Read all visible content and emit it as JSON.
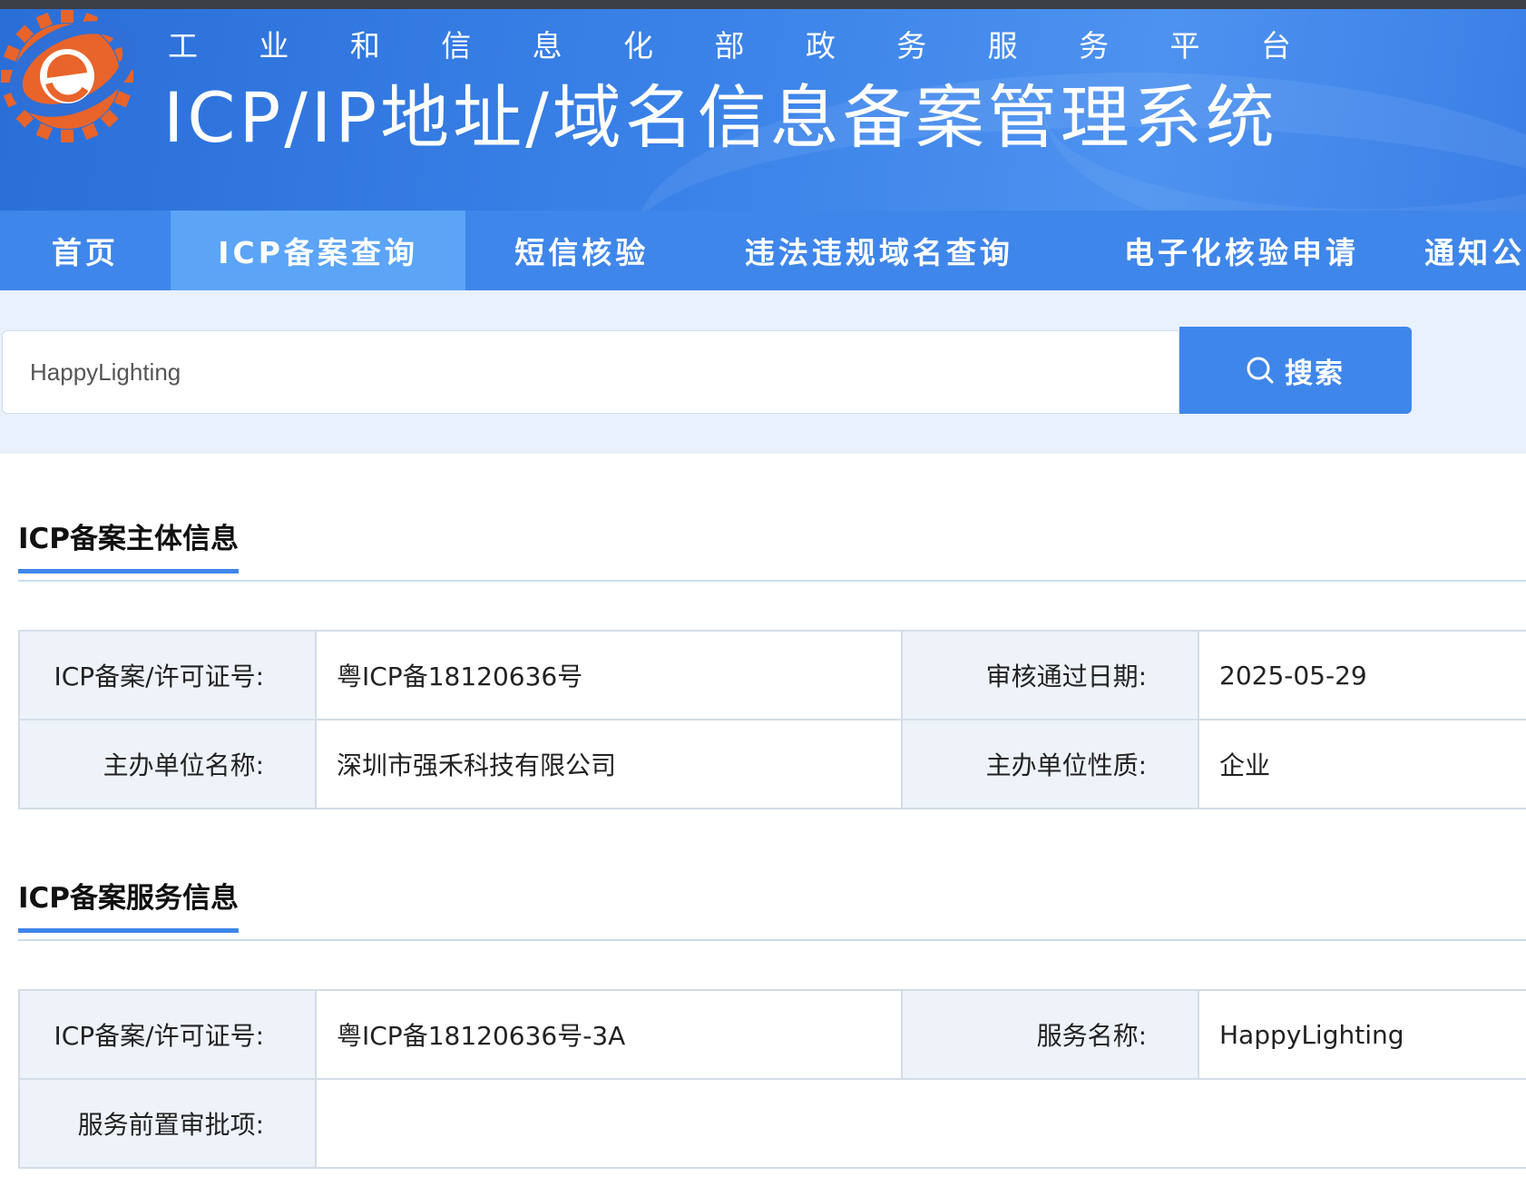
{
  "header": {
    "tagline": [
      "工",
      "业",
      "和",
      "信",
      "息",
      "化",
      "部",
      "政",
      "务",
      "服",
      "务",
      "平",
      "台"
    ],
    "system_title": "ICP/IP地址/域名信息备案管理系统",
    "colors": {
      "banner": "#3a82e8",
      "nav": "#3f86ea",
      "nav_active": "#5ba4f6",
      "logo_orange": "#e8642a"
    }
  },
  "nav": {
    "items": [
      {
        "label": "首页",
        "active": false
      },
      {
        "label": "ICP备案查询",
        "active": true
      },
      {
        "label": "短信核验",
        "active": false
      },
      {
        "label": "违法违规域名查询",
        "active": false
      },
      {
        "label": "电子化核验申请",
        "active": false
      },
      {
        "label": "通知公",
        "active": false
      }
    ]
  },
  "search": {
    "value": "HappyLighting",
    "button_label": "搜索",
    "icon": "search-icon"
  },
  "subject_section": {
    "title": "ICP备案主体信息",
    "rows": [
      [
        "ICP备案/许可证号:",
        "粤ICP备18120636号",
        "审核通过日期:",
        "2025-05-29"
      ],
      [
        "主办单位名称:",
        "深圳市强禾科技有限公司",
        "主办单位性质:",
        "企业"
      ]
    ]
  },
  "service_section": {
    "title": "ICP备案服务信息",
    "rows": [
      [
        "ICP备案/许可证号:",
        "粤ICP备18120636号-3A",
        "服务名称:",
        "HappyLighting"
      ]
    ],
    "pre_approval_label": "服务前置审批项:",
    "pre_approval_value": ""
  }
}
